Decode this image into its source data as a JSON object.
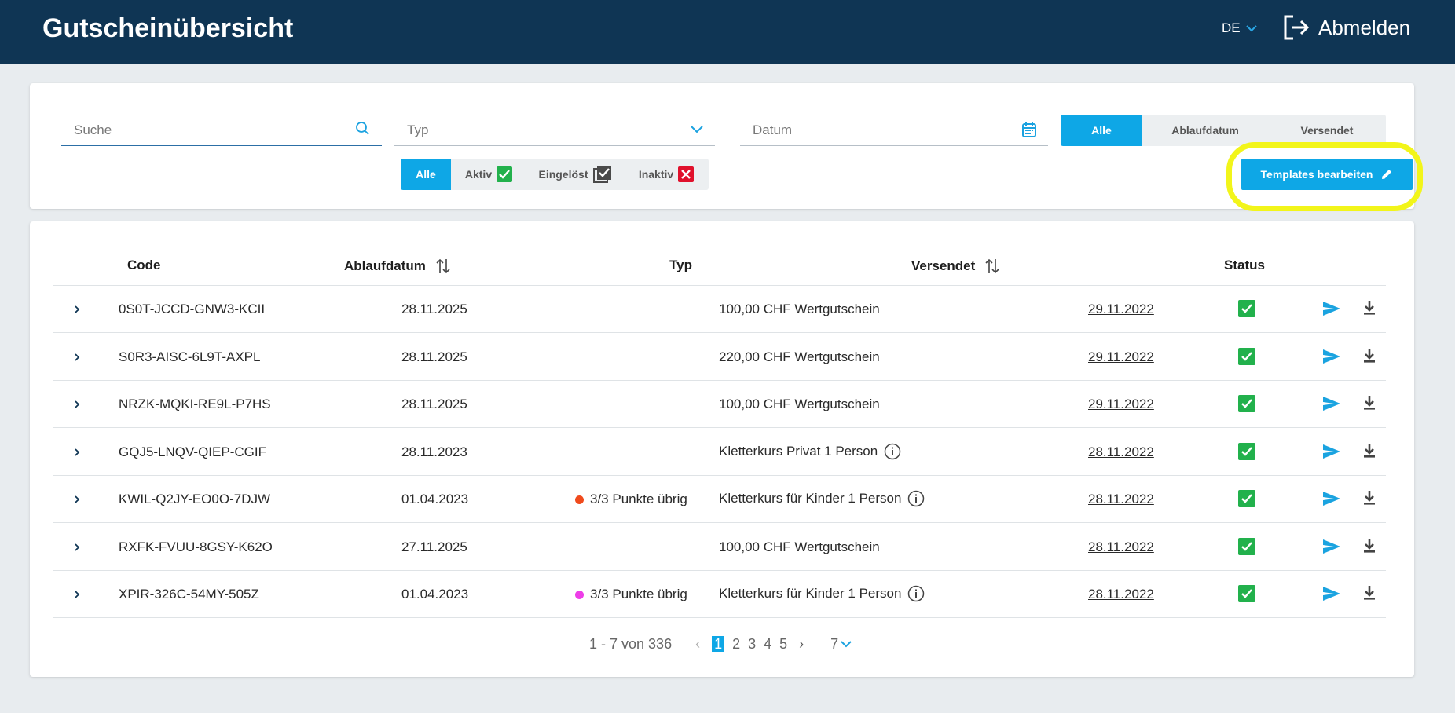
{
  "header": {
    "title": "Gutscheinübersicht",
    "language": "DE",
    "logout_label": "Abmelden"
  },
  "filters": {
    "search_placeholder": "Suche",
    "type_placeholder": "Typ",
    "date_placeholder": "Datum",
    "range_options": [
      "Alle",
      "Ablaufdatum",
      "Versendet"
    ],
    "range_selected": "Alle",
    "status_options": [
      "Alle",
      "Aktiv",
      "Eingelöst",
      "Inaktiv"
    ],
    "status_selected": "Alle",
    "templates_button": "Templates bearbeiten"
  },
  "table": {
    "columns": {
      "code": "Code",
      "expiry": "Ablaufdatum",
      "type": "Typ",
      "sent": "Versendet",
      "status": "Status"
    },
    "rows": [
      {
        "code": "0S0T-JCCD-GNW3-KCII",
        "expiry": "28.11.2025",
        "points": "",
        "points_color": "",
        "type": "100,00 CHF Wertgutschein",
        "info": false,
        "sent": "29.11.2022"
      },
      {
        "code": "S0R3-AISC-6L9T-AXPL",
        "expiry": "28.11.2025",
        "points": "",
        "points_color": "",
        "type": "220,00 CHF Wertgutschein",
        "info": false,
        "sent": "29.11.2022"
      },
      {
        "code": "NRZK-MQKI-RE9L-P7HS",
        "expiry": "28.11.2025",
        "points": "",
        "points_color": "",
        "type": "100,00 CHF Wertgutschein",
        "info": false,
        "sent": "29.11.2022"
      },
      {
        "code": "GQJ5-LNQV-QIEP-CGIF",
        "expiry": "28.11.2023",
        "points": "",
        "points_color": "",
        "type": "Kletterkurs Privat 1 Person",
        "info": true,
        "sent": "28.11.2022"
      },
      {
        "code": "KWIL-Q2JY-EO0O-7DJW",
        "expiry": "01.04.2023",
        "points": "3/3 Punkte übrig",
        "points_color": "#f04a1c",
        "type": "Kletterkurs für Kinder 1 Person",
        "info": true,
        "sent": "28.11.2022"
      },
      {
        "code": "RXFK-FVUU-8GSY-K62O",
        "expiry": "27.11.2025",
        "points": "",
        "points_color": "",
        "type": "100,00 CHF Wertgutschein",
        "info": false,
        "sent": "28.11.2022"
      },
      {
        "code": "XPIR-326C-54MY-505Z",
        "expiry": "01.04.2023",
        "points": "3/3 Punkte übrig",
        "points_color": "#ee3ee8",
        "type": "Kletterkurs für Kinder 1 Person",
        "info": true,
        "sent": "28.11.2022"
      }
    ]
  },
  "pagination": {
    "summary": "1 - 7 von 336",
    "pages": [
      "1",
      "2",
      "3",
      "4",
      "5"
    ],
    "current": "1",
    "page_size": "7"
  },
  "colors": {
    "header_bg": "#0f3554",
    "accent": "#0ea7e6",
    "active_green": "#22b14c",
    "inactive_red": "#e0112c",
    "redeemed_gray": "#4a4a4a",
    "highlight": "#f2f51a"
  }
}
